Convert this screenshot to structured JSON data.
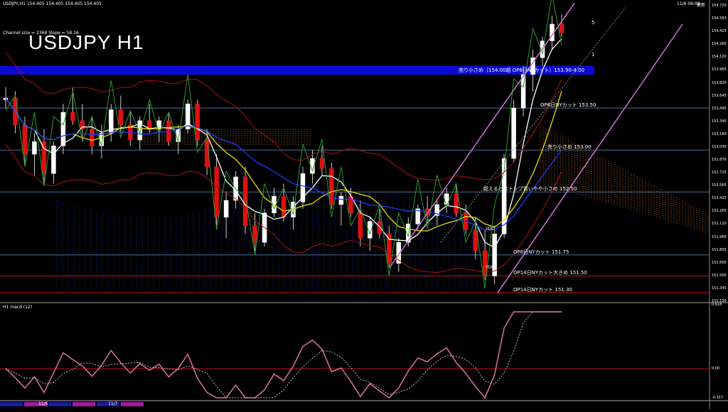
{
  "header": {
    "symbol_line": "USDJPY,H1  154.405 154.405 154.405 154.405",
    "channel_line": "Channel size = 2368 Slope = 58.16",
    "big_title": "USDJPY H1",
    "server_time": "11/6 06:08",
    "server_time_suffix": "更新",
    "macd_label": "H1  macd (12)"
  },
  "chart_data": {
    "type": "line",
    "price_axis": {
      "ylim": [
        151.199,
        154.72
      ],
      "ticks": [
        "154.720",
        "154.563",
        "154.425",
        "154.260",
        "154.120",
        "153.965",
        "153.820",
        "153.645",
        "153.495",
        "153.340",
        "153.180",
        "153.030",
        "152.870",
        "152.725",
        "152.565",
        "152.425",
        "152.265",
        "152.110",
        "151.965",
        "151.805",
        "151.650",
        "151.500",
        "151.345",
        "151.199"
      ]
    },
    "macd_axis": {
      "ticks": [
        "0.618",
        "0.00",
        "-0.317"
      ]
    },
    "date_markers": [
      "11/6",
      "11/7"
    ],
    "levels": [
      {
        "label": "売り小さめ（154.00超 OP8日NYカット）153.90-4.00",
        "price": 153.95,
        "color": "#0a0ad8",
        "band": true
      },
      {
        "label": "OP6日NYカット 153.50",
        "price": 153.5,
        "color": "#4a6a9a"
      },
      {
        "label": "売り小さめ 153.00",
        "price": 153.0,
        "color": "#4a6a9a"
      },
      {
        "label": "超えるとストップ買いやや小さめ 152.50",
        "price": 152.5,
        "color": "#4a6a9a"
      },
      {
        "label": "OP8日NYカット 151.75",
        "price": 151.75,
        "color": "#4a6a9a"
      },
      {
        "label": "OP14日NYカット大きめ 151.50",
        "price": 151.5,
        "color": "#cc1010"
      },
      {
        "label": "OP14日NYカット 151.30",
        "price": 151.3,
        "color": "#cc1010"
      }
    ],
    "right_markers": [
      "5",
      "1"
    ],
    "box_labels": [
      "YDC",
      "YDC"
    ],
    "price_series": [
      [
        153.6,
        153.75,
        153.5,
        153.62
      ],
      [
        153.62,
        153.7,
        153.2,
        153.3
      ],
      [
        153.3,
        153.4,
        152.8,
        152.95
      ],
      [
        152.95,
        153.2,
        152.7,
        153.1
      ],
      [
        153.1,
        153.25,
        152.6,
        152.72
      ],
      [
        152.72,
        153.1,
        152.6,
        153.05
      ],
      [
        153.05,
        153.55,
        152.95,
        153.45
      ],
      [
        153.45,
        153.75,
        153.3,
        153.35
      ],
      [
        153.35,
        153.55,
        153.1,
        153.25
      ],
      [
        153.25,
        153.4,
        152.95,
        153.05
      ],
      [
        153.05,
        153.3,
        152.9,
        153.2
      ],
      [
        153.2,
        153.55,
        153.1,
        153.48
      ],
      [
        153.48,
        153.65,
        153.2,
        153.3
      ],
      [
        153.3,
        153.45,
        153.05,
        153.12
      ],
      [
        153.12,
        153.4,
        153.0,
        153.35
      ],
      [
        153.35,
        153.55,
        153.2,
        153.25
      ],
      [
        153.25,
        153.4,
        153.1,
        153.35
      ],
      [
        153.35,
        153.45,
        153.05,
        153.1
      ],
      [
        153.1,
        153.3,
        152.95,
        153.25
      ],
      [
        153.25,
        153.6,
        153.2,
        153.55
      ],
      [
        153.55,
        153.6,
        153.05,
        153.12
      ],
      [
        153.12,
        153.25,
        152.7,
        152.8
      ],
      [
        152.8,
        152.95,
        152.1,
        152.2
      ],
      [
        152.2,
        152.5,
        151.95,
        152.4
      ],
      [
        152.4,
        152.75,
        152.3,
        152.68
      ],
      [
        152.68,
        152.8,
        152.0,
        152.1
      ],
      [
        152.1,
        152.25,
        151.8,
        151.9
      ],
      [
        151.9,
        152.3,
        151.85,
        152.25
      ],
      [
        152.25,
        152.55,
        152.2,
        152.45
      ],
      [
        152.45,
        152.6,
        152.15,
        152.2
      ],
      [
        152.2,
        152.45,
        152.05,
        152.38
      ],
      [
        152.38,
        152.8,
        152.3,
        152.72
      ],
      [
        152.72,
        153.0,
        152.6,
        152.9
      ],
      [
        152.9,
        153.05,
        152.7,
        152.78
      ],
      [
        152.78,
        152.85,
        152.3,
        152.35
      ],
      [
        152.35,
        152.5,
        152.1,
        152.45
      ],
      [
        152.45,
        152.55,
        152.2,
        152.25
      ],
      [
        152.25,
        152.4,
        151.85,
        151.95
      ],
      [
        151.95,
        152.2,
        151.8,
        152.15
      ],
      [
        152.15,
        152.3,
        151.95,
        152.0
      ],
      [
        152.0,
        152.1,
        151.6,
        151.65
      ],
      [
        151.65,
        151.95,
        151.55,
        151.9
      ],
      [
        151.9,
        152.2,
        151.85,
        152.12
      ],
      [
        152.12,
        152.35,
        152.05,
        152.3
      ],
      [
        152.3,
        152.45,
        152.15,
        152.22
      ],
      [
        152.22,
        152.4,
        152.1,
        152.35
      ],
      [
        152.35,
        152.55,
        152.25,
        152.48
      ],
      [
        152.48,
        152.6,
        152.2,
        152.25
      ],
      [
        152.25,
        152.35,
        152.0,
        152.05
      ],
      [
        152.05,
        152.2,
        151.7,
        151.8
      ],
      [
        151.8,
        152.05,
        151.45,
        151.5
      ],
      [
        151.5,
        152.1,
        151.4,
        152.0
      ],
      [
        152.0,
        152.95,
        151.95,
        152.9
      ],
      [
        152.9,
        153.6,
        152.85,
        153.5
      ],
      [
        153.5,
        154.0,
        153.4,
        153.9
      ],
      [
        153.9,
        154.2,
        153.7,
        154.1
      ],
      [
        154.1,
        154.35,
        154.0,
        154.3
      ],
      [
        154.3,
        154.6,
        154.2,
        154.5
      ],
      [
        154.5,
        154.62,
        154.35,
        154.4
      ]
    ]
  }
}
